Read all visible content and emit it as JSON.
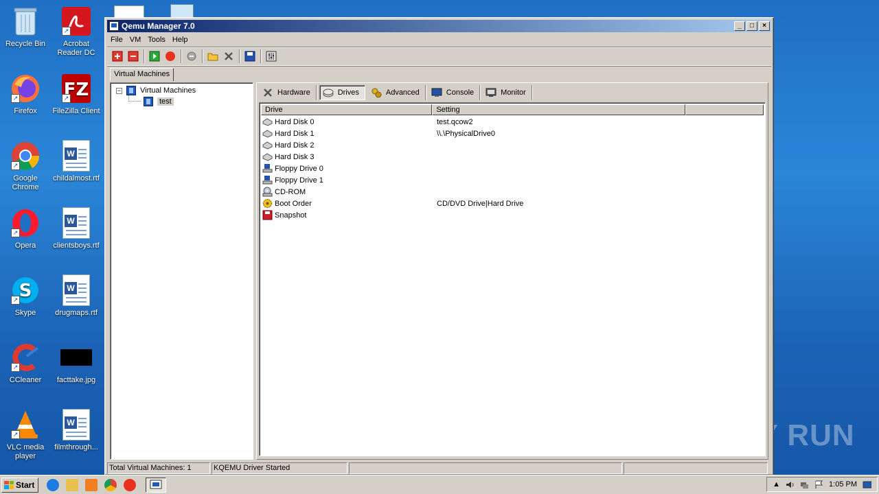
{
  "desktop": {
    "icons": [
      {
        "label": "Recycle Bin"
      },
      {
        "label": "Acrobat Reader DC"
      },
      {
        "label": "Firefox"
      },
      {
        "label": "FileZilla Client"
      },
      {
        "label": "Google Chrome"
      },
      {
        "label": "childalmost.rtf"
      },
      {
        "label": "Opera"
      },
      {
        "label": "clientsboys.rtf"
      },
      {
        "label": "Skype"
      },
      {
        "label": "drugmaps.rtf"
      },
      {
        "label": "CCleaner"
      },
      {
        "label": "facttake.jpg"
      },
      {
        "label": "VLC media player"
      },
      {
        "label": "filmthrough..."
      }
    ],
    "watermark": "ANY RUN"
  },
  "window": {
    "title": "Qemu Manager 7.0",
    "menu": [
      "File",
      "VM",
      "Tools",
      "Help"
    ],
    "toolbar_icons": [
      "add-vm-icon",
      "remove-vm-icon",
      "play-icon",
      "stop-icon",
      "refresh-icon",
      "open-folder-icon",
      "tools-icon",
      "save-icon",
      "settings-icon"
    ],
    "tab": "Virtual Machines",
    "tree": {
      "root": "Virtual Machines",
      "child": "test"
    },
    "subtabs": [
      "Hardware",
      "Drives",
      "Advanced",
      "Console",
      "Monitor"
    ],
    "active_subtab": "Drives",
    "columns": [
      "Drive",
      "Setting"
    ],
    "rows": [
      {
        "drive": "Hard Disk 0",
        "setting": "test.qcow2",
        "icon": "harddisk-icon"
      },
      {
        "drive": "Hard Disk 1",
        "setting": "\\\\.\\PhysicalDrive0",
        "icon": "harddisk-icon"
      },
      {
        "drive": "Hard Disk 2",
        "setting": "",
        "icon": "harddisk-icon"
      },
      {
        "drive": "Hard Disk 3",
        "setting": "",
        "icon": "harddisk-icon"
      },
      {
        "drive": "Floppy Drive 0",
        "setting": "",
        "icon": "floppy-icon"
      },
      {
        "drive": "Floppy Drive 1",
        "setting": "",
        "icon": "floppy-icon"
      },
      {
        "drive": "CD-ROM",
        "setting": "",
        "icon": "cdrom-icon"
      },
      {
        "drive": "Boot Order",
        "setting": "CD/DVD Drive|Hard Drive",
        "icon": "boot-order-icon"
      },
      {
        "drive": "Snapshot",
        "setting": "",
        "icon": "snapshot-icon"
      }
    ],
    "status": {
      "left": "Total Virtual Machines: 1",
      "middle": "KQEMU Driver Started"
    }
  },
  "taskbar": {
    "start": "Start",
    "clock": "1:05 PM"
  },
  "colors": {
    "title_start": "#0a246a",
    "title_end": "#a6caf0",
    "face": "#d4d0c8"
  }
}
